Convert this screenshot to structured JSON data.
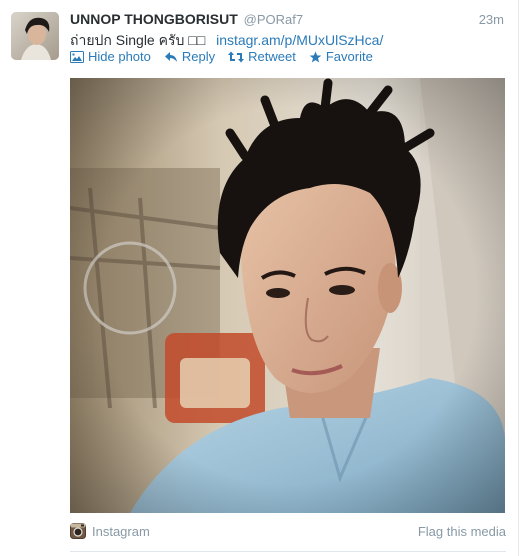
{
  "tweet": {
    "full_name": "UNNOP THONGBORISUT",
    "handle": "@PORaf7",
    "time": "23m",
    "text": "ถ่ายปก Single ครับ □□",
    "link": "instagr.am/p/MUxUlSzHca/"
  },
  "actions": {
    "hide_photo": "Hide photo",
    "reply": "Reply",
    "retweet": "Retweet",
    "favorite": "Favorite"
  },
  "media": {
    "source": "Instagram",
    "flag": "Flag this media"
  },
  "colors": {
    "link": "#2b7bb9",
    "muted": "#8899a6",
    "name": "#292f33"
  }
}
